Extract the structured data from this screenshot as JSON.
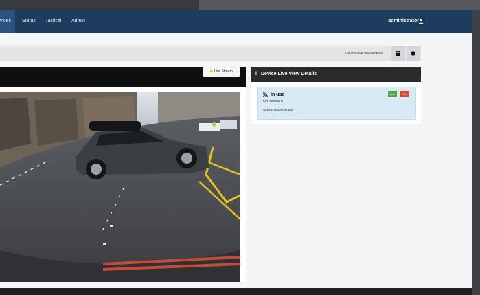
{
  "nav": {
    "items": [
      {
        "label": "vices",
        "active": true
      },
      {
        "label": "Status",
        "active": false
      },
      {
        "label": "Tactical",
        "active": false
      },
      {
        "label": "Admin",
        "active": false
      }
    ],
    "user": "administrator"
  },
  "toolbar": {
    "actions_label": "Device Live View Actions :"
  },
  "video": {
    "live_stream_label": "Live Stream"
  },
  "details": {
    "title": "Device Live View Details",
    "status": "In use",
    "substatus": "Live streaming",
    "started": "Stream started 4s ago",
    "badge_live": "Live",
    "badge_rec": "Rec"
  },
  "colors": {
    "navbar": "#1e3c5e",
    "live_badge": "#5aa34e",
    "rec_badge": "#d24a3f",
    "status_bg": "#d8ebf4"
  }
}
